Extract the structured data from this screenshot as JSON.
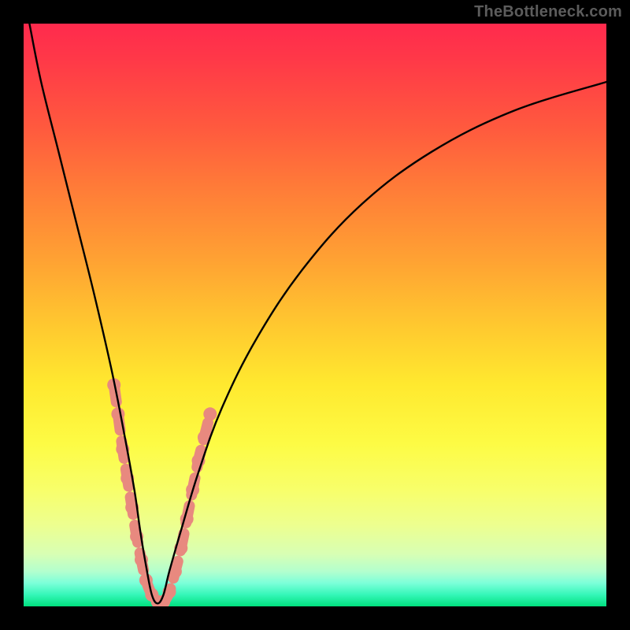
{
  "watermark": {
    "text": "TheBottleneck.com"
  },
  "chart_data": {
    "type": "line",
    "title": "",
    "xlabel": "",
    "ylabel": "",
    "xlim": [
      0,
      100
    ],
    "ylim": [
      0,
      100
    ],
    "bottleneck_x": 23,
    "series": [
      {
        "name": "bottleneck-curve",
        "color": "#000000",
        "x": [
          1,
          3,
          6,
          9,
          12,
          15,
          17,
          19,
          20,
          21,
          22,
          23,
          24,
          25,
          27,
          30,
          34,
          40,
          48,
          58,
          70,
          84,
          100
        ],
        "y": [
          100,
          90,
          78,
          66,
          54,
          41,
          31,
          20,
          13,
          7,
          2,
          0.5,
          2,
          6,
          13,
          23,
          34,
          46,
          58,
          69,
          78,
          85,
          90
        ]
      }
    ],
    "salmon_band": {
      "color": "#e8897f",
      "notes": "thick overlay segments near trough",
      "points": [
        {
          "x": 15.5,
          "y": 38
        },
        {
          "x": 16.2,
          "y": 33
        },
        {
          "x": 17.0,
          "y": 27
        },
        {
          "x": 17.8,
          "y": 22
        },
        {
          "x": 18.6,
          "y": 17
        },
        {
          "x": 19.4,
          "y": 12
        },
        {
          "x": 20.2,
          "y": 8
        },
        {
          "x": 21.0,
          "y": 4.5
        },
        {
          "x": 22.0,
          "y": 2
        },
        {
          "x": 23.0,
          "y": 0.8
        },
        {
          "x": 24.0,
          "y": 0.8
        },
        {
          "x": 25.0,
          "y": 2.5
        },
        {
          "x": 26.0,
          "y": 6
        },
        {
          "x": 27.0,
          "y": 10
        },
        {
          "x": 28.0,
          "y": 15
        },
        {
          "x": 29.0,
          "y": 20
        },
        {
          "x": 30.0,
          "y": 25
        },
        {
          "x": 31.0,
          "y": 29
        },
        {
          "x": 32.0,
          "y": 33
        }
      ]
    }
  }
}
